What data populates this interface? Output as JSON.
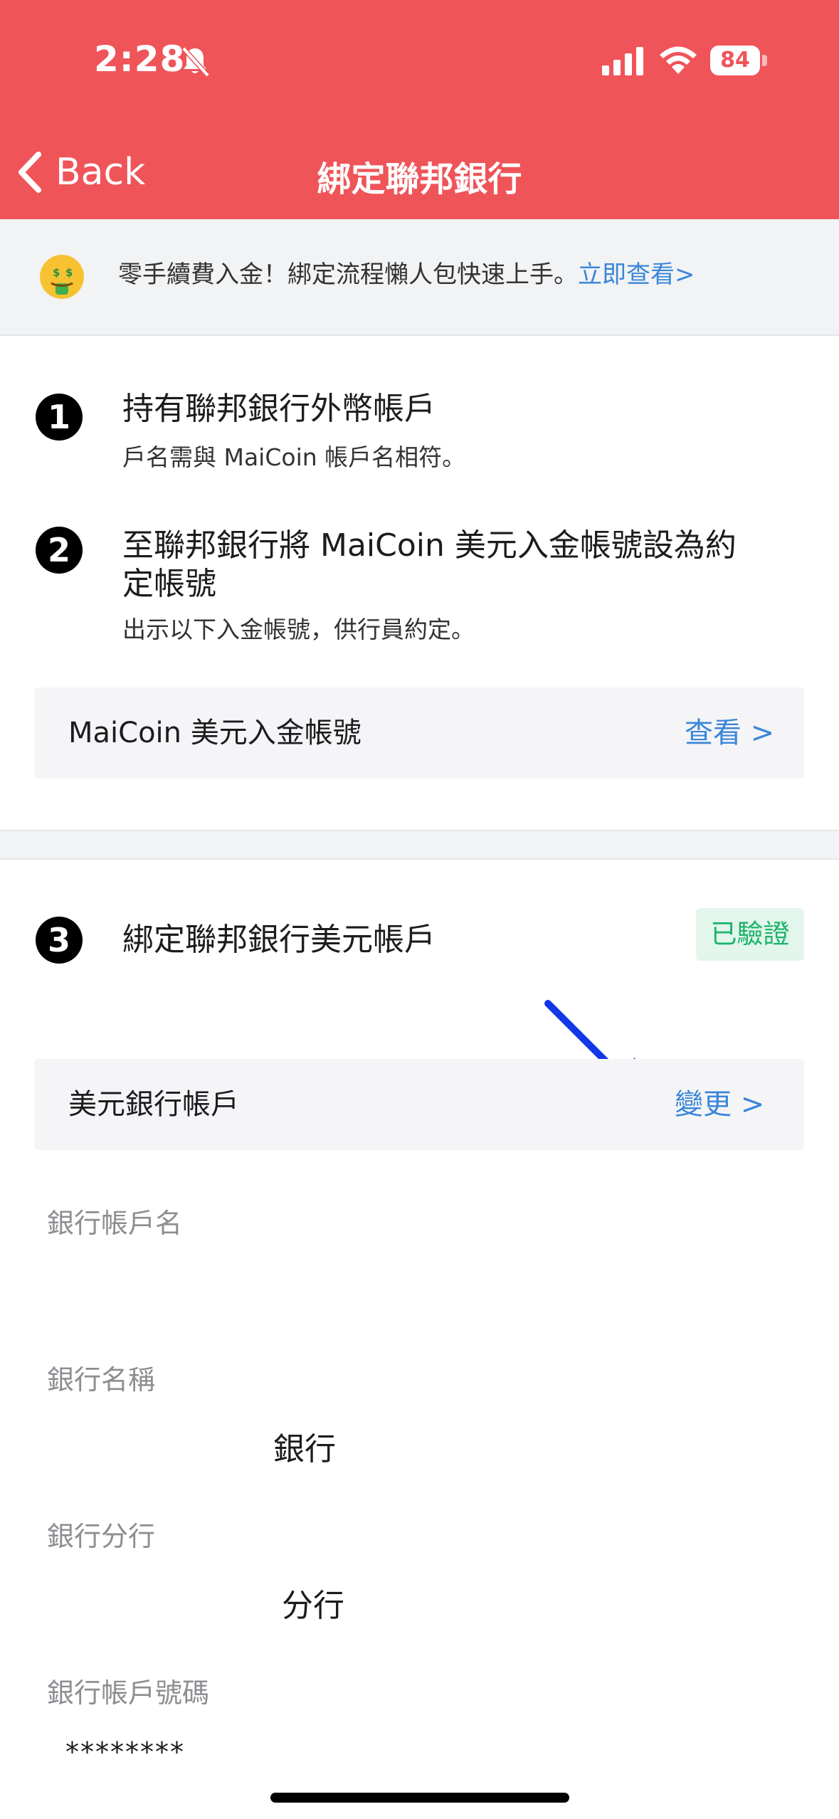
{
  "status_bar": {
    "time": "2:28",
    "battery": "84"
  },
  "nav": {
    "back_label": "Back",
    "title": "綁定聯邦銀行"
  },
  "banner": {
    "text": "零手續費入金！綁定流程懶人包快速上手。",
    "link": "立即查看>"
  },
  "steps": [
    {
      "number": "1",
      "title": "持有聯邦銀行外幣帳戶",
      "desc": "戶名需與 MaiCoin 帳戶名相符。"
    },
    {
      "number": "2",
      "title_line1": "至聯邦銀行將 MaiCoin 美元入金帳號設為約",
      "title_line2": "定帳號",
      "desc": "出示以下入金帳號，供行員約定。"
    },
    {
      "number": "3",
      "title": "綁定聯邦銀行美元帳戶",
      "badge": "已驗證"
    }
  ],
  "deposit_account_row": {
    "label": "MaiCoin 美元入金帳號",
    "action": "查看 >"
  },
  "usd_bank_row": {
    "label": "美元銀行帳戶",
    "action": "變更 >"
  },
  "fields": [
    {
      "label": "銀行帳戶名",
      "value": ""
    },
    {
      "label": "銀行名稱",
      "value": "銀行"
    },
    {
      "label": "銀行分行",
      "value": "分行"
    },
    {
      "label": "銀行帳戶號碼",
      "value": "********"
    }
  ],
  "colors": {
    "header": "#ef5459",
    "link": "#3a86d8",
    "verified": "#1db36b",
    "annotation_arrow": "#1237e8"
  }
}
